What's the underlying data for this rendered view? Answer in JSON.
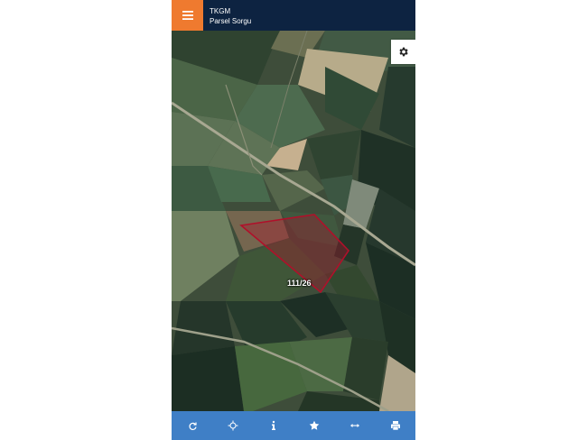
{
  "header": {
    "title": "TKGM",
    "subtitle": "Parsel Sorgu"
  },
  "icons": {
    "menu": "hamburger-menu-icon",
    "settings": "gear-icon",
    "toolbar": [
      "refresh-icon",
      "crosshair-icon",
      "info-icon",
      "star-icon",
      "measure-icon",
      "print-icon"
    ]
  },
  "map": {
    "parcel_label": "111/26"
  },
  "colors": {
    "header_bg": "#0d2341",
    "menu_button": "#ef7a2f",
    "toolbar_bg": "#3f7fc6",
    "parcel_outline": "#b0102a",
    "parcel_fill": "#b0102a"
  }
}
